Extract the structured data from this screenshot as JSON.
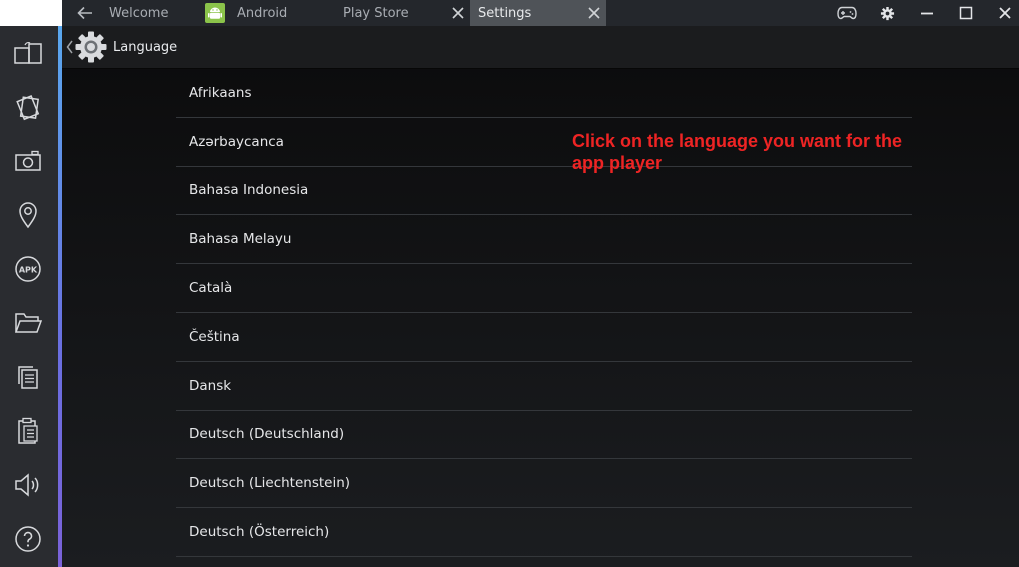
{
  "tabs": [
    {
      "label": "Welcome"
    },
    {
      "label": "Android"
    },
    {
      "label": "Play Store"
    },
    {
      "label": "Settings"
    }
  ],
  "header": {
    "title": "Language"
  },
  "languages": [
    "Afrikaans",
    "Azərbaycanca",
    "Bahasa Indonesia",
    "Bahasa Melayu",
    "Català",
    "Čeština",
    "Dansk",
    "Deutsch (Deutschland)",
    "Deutsch (Liechtenstein)",
    "Deutsch (Österreich)"
  ],
  "callout": {
    "text": "Click on the language you want for the app player"
  },
  "colors": {
    "accent": "#6a6fe0",
    "callout": "#ee2424",
    "active_tab": "#4f5358"
  },
  "icons": {
    "sidebar": [
      "rotate-screen-icon",
      "shake-icon",
      "camera-icon",
      "location-pin-icon",
      "apk-icon",
      "folder-icon",
      "copy-icon",
      "paste-icon",
      "volume-icon",
      "help-icon"
    ]
  }
}
